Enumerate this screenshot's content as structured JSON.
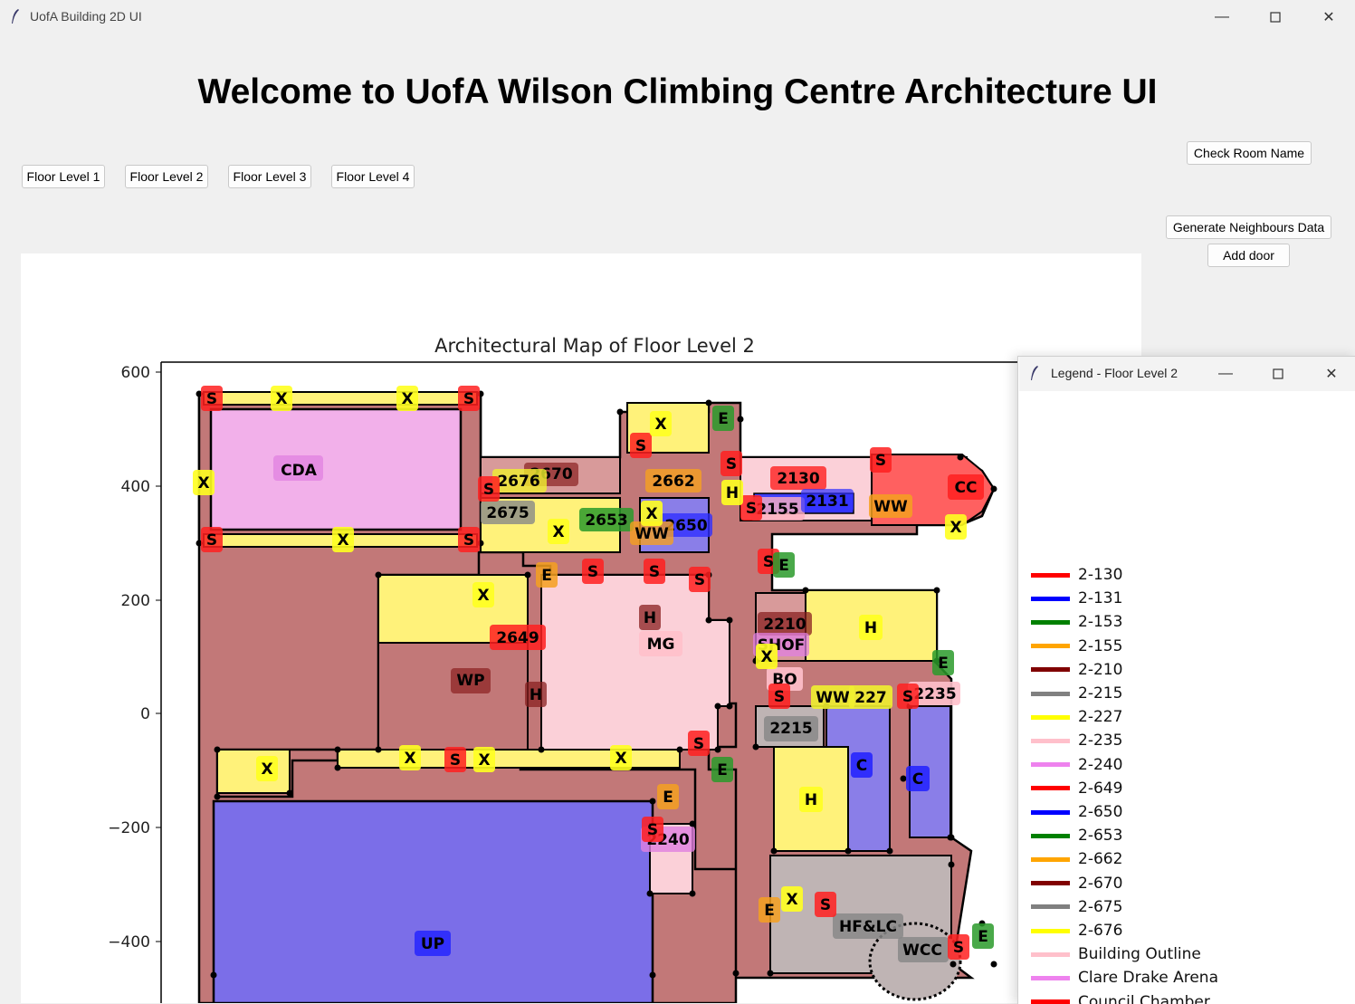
{
  "window": {
    "title": "UofA Building 2D UI"
  },
  "header": {
    "title": "Welcome to UofA Wilson Climbing Centre Architecture UI"
  },
  "floor_buttons": [
    "Floor Level 1",
    "Floor Level 2",
    "Floor Level 3",
    "Floor Level 4"
  ],
  "actions": {
    "check_room": "Check Room Name",
    "generate_neighbours": "Generate Neighbours Data",
    "add_door": "Add door"
  },
  "map": {
    "title": "Architectural Map of Floor Level 2",
    "y_ticks": [
      "600",
      "400",
      "200",
      "0",
      "−200",
      "−400"
    ],
    "labels": [
      "CDA",
      "2670",
      "2676",
      "2675",
      "2662",
      "2653",
      "2650",
      "WW",
      "2130",
      "2155",
      "2131",
      "WW",
      "CC",
      "2210",
      "SHOF",
      "H",
      "MG",
      "WP",
      "2649",
      "BO",
      "2215",
      "WW",
      "227",
      "2235",
      "H",
      "C",
      "C",
      "2240",
      "UP",
      "HF&LC",
      "WCC",
      "S",
      "X",
      "E",
      "H"
    ]
  },
  "legend": {
    "title": "Legend - Floor Level 2",
    "items": [
      {
        "label": "2-130",
        "color": "#ff0000"
      },
      {
        "label": "2-131",
        "color": "#0000ff"
      },
      {
        "label": "2-153",
        "color": "#008000"
      },
      {
        "label": "2-155",
        "color": "#ffa500"
      },
      {
        "label": "2-210",
        "color": "#800000"
      },
      {
        "label": "2-215",
        "color": "#808080"
      },
      {
        "label": "2-227",
        "color": "#ffff00"
      },
      {
        "label": "2-235",
        "color": "#ffc0cb"
      },
      {
        "label": "2-240",
        "color": "#ee82ee"
      },
      {
        "label": "2-649",
        "color": "#ff0000"
      },
      {
        "label": "2-650",
        "color": "#0000ff"
      },
      {
        "label": "2-653",
        "color": "#008000"
      },
      {
        "label": "2-662",
        "color": "#ffa500"
      },
      {
        "label": "2-670",
        "color": "#800000"
      },
      {
        "label": "2-675",
        "color": "#808080"
      },
      {
        "label": "2-676",
        "color": "#ffff00"
      },
      {
        "label": "Building Outline",
        "color": "#ffc0cb"
      },
      {
        "label": "Clare Drake Arena",
        "color": "#ee82ee"
      },
      {
        "label": "Council Chamber",
        "color": "#ff0000"
      }
    ]
  }
}
